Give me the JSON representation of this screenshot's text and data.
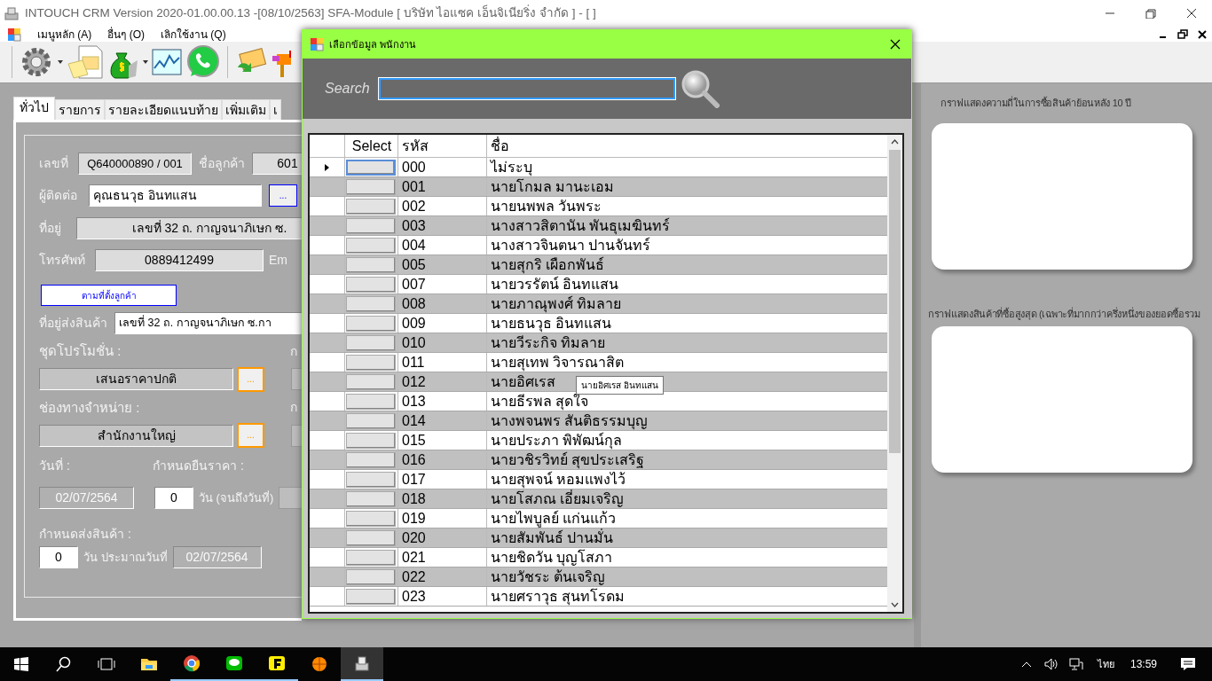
{
  "window": {
    "title": "INTOUCH CRM Version 2020-01.00.00.13 -[08/10/2563] SFA-Module  [ บริษัท ไอแซค เอ็นจิเนียริ่ง จำกัด ] - [ ]"
  },
  "menu": [
    "เมนูหลัก (A)",
    "อื่นๆ (O)",
    "เลิกใช้งาน (Q)"
  ],
  "tabs": [
    {
      "label": "ทั่วไป",
      "selected": true
    },
    {
      "label": "รายการ",
      "selected": false
    },
    {
      "label": "รายละเอียดแนบท้าย",
      "selected": false
    },
    {
      "label": "เพิ่มเติม",
      "selected": false
    },
    {
      "label": "เ",
      "selected": false
    }
  ],
  "form": {
    "doc_no": {
      "label": "เลขที่",
      "value": "Q640000890 / 001"
    },
    "customer": {
      "label": "ชื่อลูกค้า",
      "value": "601"
    },
    "contact": {
      "label": "ผู้ติดต่อ",
      "value": "คุณธนวุธ อินทแสน",
      "button": "..."
    },
    "address": {
      "label": "ที่อยู่",
      "value": "เลขที่  32  ถ. กาญจนาภิเษก  ซ."
    },
    "phone": {
      "label": "โทรศัพท์",
      "value": "0889412499",
      "next_label": "Em"
    },
    "locate_button": "ตามที่ตั้งลูกค้า",
    "ship_address": {
      "label": "ที่อยู่ส่งสินค้า",
      "value": "เลขที่  32  ถ. กาญจนาภิเษก  ซ.กา"
    },
    "promotion": {
      "label": "ชุดโปรโมชั่น :",
      "value": "เสนอราคาปกติ",
      "button": "...",
      "side_label": "ก"
    },
    "channel": {
      "label": "ช่องทางจำหน่าย  :",
      "value": "สำนักงานใหญ่",
      "button": "...",
      "side_label": "ก"
    },
    "date": {
      "label": "วันที่ :",
      "value": "02/07/2564",
      "disabled": true
    },
    "price_valid": {
      "label": "กำหนดยืนราคา :",
      "value": "0",
      "unit": "วัน (จนถึงวันที่)"
    },
    "delivery": {
      "label": "กำหนดส่งสินค้า :",
      "value": "0",
      "unit": "วัน ประมาณวันที่",
      "date": {
        "value": "02/07/2564",
        "disabled": true
      }
    }
  },
  "charts": [
    {
      "title": "กราฟแสดงความถี่ในการซื้อสินค้าย้อนหลัง 10 ปี"
    },
    {
      "title": "กราฟแสดงสินค้าที่ซื้อสูงสุด (เฉพาะที่มากกว่าครึ่งหนึ่งของยอดซื้อรวม"
    }
  ],
  "dialog": {
    "title": "เลือกข้อมูล พนักงาน",
    "search": {
      "label": "Search"
    },
    "grid": {
      "columns": [
        "Select",
        "รหัส",
        "ชื่อ"
      ],
      "rows": [
        {
          "code": "000",
          "name": "ไม่ระบุ",
          "selected": true
        },
        {
          "code": "001",
          "name": "นายโกมล มานะเอม",
          "selected": false
        },
        {
          "code": "002",
          "name": "นายนพพล วันพระ",
          "selected": false
        },
        {
          "code": "003",
          "name": "นางสาวสิตานัน พันธุเมฆินทร์",
          "selected": false
        },
        {
          "code": "004",
          "name": "นางสาวจินตนา ปานจันทร์",
          "selected": false
        },
        {
          "code": "005",
          "name": "นายสุกริ เผือกพันธ์",
          "selected": false
        },
        {
          "code": "007",
          "name": "นายวรรัตน์ อินทแสน",
          "selected": false
        },
        {
          "code": "008",
          "name": "นายภาณุพงศ์ ทิมลาย",
          "selected": false
        },
        {
          "code": "009",
          "name": "นายธนวุธ อินทแสน",
          "selected": false
        },
        {
          "code": "010",
          "name": "นายวีระกิจ ทิมลาย",
          "selected": false
        },
        {
          "code": "011",
          "name": "นายสุเทพ วิจารณาสิต",
          "selected": false
        },
        {
          "code": "012",
          "name": "นายอิศเรส",
          "selected": false
        },
        {
          "code": "013",
          "name": "นายธีรพล สุดใจ",
          "selected": false
        },
        {
          "code": "014",
          "name": "นางพจนพร สันติธรรมบุญ",
          "selected": false
        },
        {
          "code": "015",
          "name": "นายประภา พิพัฒน์กุล",
          "selected": false
        },
        {
          "code": "016",
          "name": "นายวชิรวิทย์ สุขประเสริฐ",
          "selected": false
        },
        {
          "code": "017",
          "name": "นายสุพจน์  หอมแพงไว้",
          "selected": false
        },
        {
          "code": "018",
          "name": "นายโสภณ  เอี่ยมเจริญ",
          "selected": false
        },
        {
          "code": "019",
          "name": "นายไพบูลย์ แก่นแก้ว",
          "selected": false
        },
        {
          "code": "020",
          "name": "นายสัมพันธ์ ปานมั่น",
          "selected": false
        },
        {
          "code": "021",
          "name": "นายชิดวัน บุญโสภา",
          "selected": false
        },
        {
          "code": "022",
          "name": "นายวัชระ ต้นเจริญ",
          "selected": false
        },
        {
          "code": "023",
          "name": "นายศราวุธ สุนทโรดม",
          "selected": false
        }
      ]
    },
    "tooltip": "นายอิศเรส อินทแสน"
  },
  "taskbar": {
    "apps": [
      {
        "kind": "folder",
        "running": false
      },
      {
        "kind": "chrome",
        "running": true
      },
      {
        "kind": "chat",
        "running": true
      },
      {
        "kind": "f",
        "running": true
      },
      {
        "kind": "ball",
        "running": false
      },
      {
        "kind": "app",
        "running": true
      }
    ],
    "ime": "ไทย",
    "time": "13:59"
  }
}
